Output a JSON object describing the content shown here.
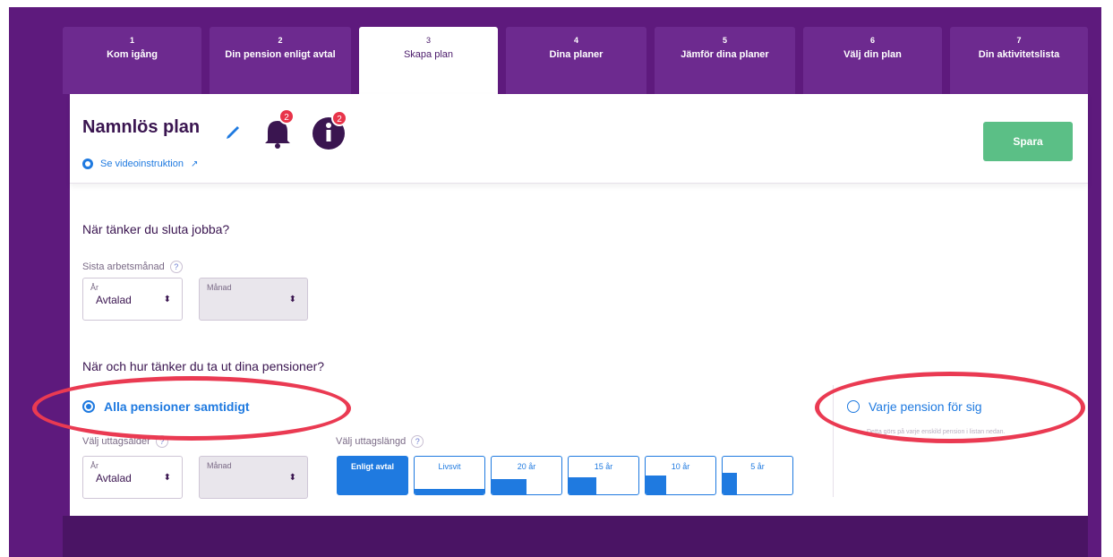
{
  "tabs": [
    {
      "num": "1",
      "label": "Kom igång"
    },
    {
      "num": "2",
      "label": "Din pension enligt avtal"
    },
    {
      "num": "3",
      "label": "Skapa plan"
    },
    {
      "num": "4",
      "label": "Dina planer"
    },
    {
      "num": "5",
      "label": "Jämför dina planer"
    },
    {
      "num": "6",
      "label": "Välj din plan"
    },
    {
      "num": "7",
      "label": "Din aktivitetslista"
    }
  ],
  "header": {
    "plan_title": "Namnlös plan",
    "bell_badge": "2",
    "info_badge": "2",
    "video_link": "Se videoinstruktion",
    "save_label": "Spara"
  },
  "section1": {
    "question": "När tänker du sluta jobba?",
    "last_month_label": "Sista arbetsmånad",
    "help": "?",
    "year_caption": "År",
    "year_value": "Avtalad",
    "month_caption": "Månad",
    "month_value": ""
  },
  "section2": {
    "question": "När och hur tänker du ta ut dina pensioner?",
    "option_all": "Alla pensioner samtidigt",
    "option_each": "Varje pension för sig",
    "option_each_note": "Detta görs på varje enskild pension i listan nedan.",
    "choose_age_label": "Välj uttagsålder",
    "choose_period_label": "Välj uttagslängd",
    "help": "?",
    "year_caption": "År",
    "year_value": "Avtalad",
    "month_caption": "Månad",
    "month_value": "",
    "periods": [
      "Enligt avtal",
      "Livsvit",
      "20 år",
      "15 år",
      "10 år",
      "5 år"
    ],
    "period_shares": [
      1.0,
      1.0,
      0.5,
      0.4,
      0.3,
      0.2
    ]
  },
  "colors": {
    "brand_purple": "#5e1a7d",
    "link_blue": "#1f7ae0",
    "save_green": "#5bbf86",
    "highlight_red": "#ea3a52"
  }
}
